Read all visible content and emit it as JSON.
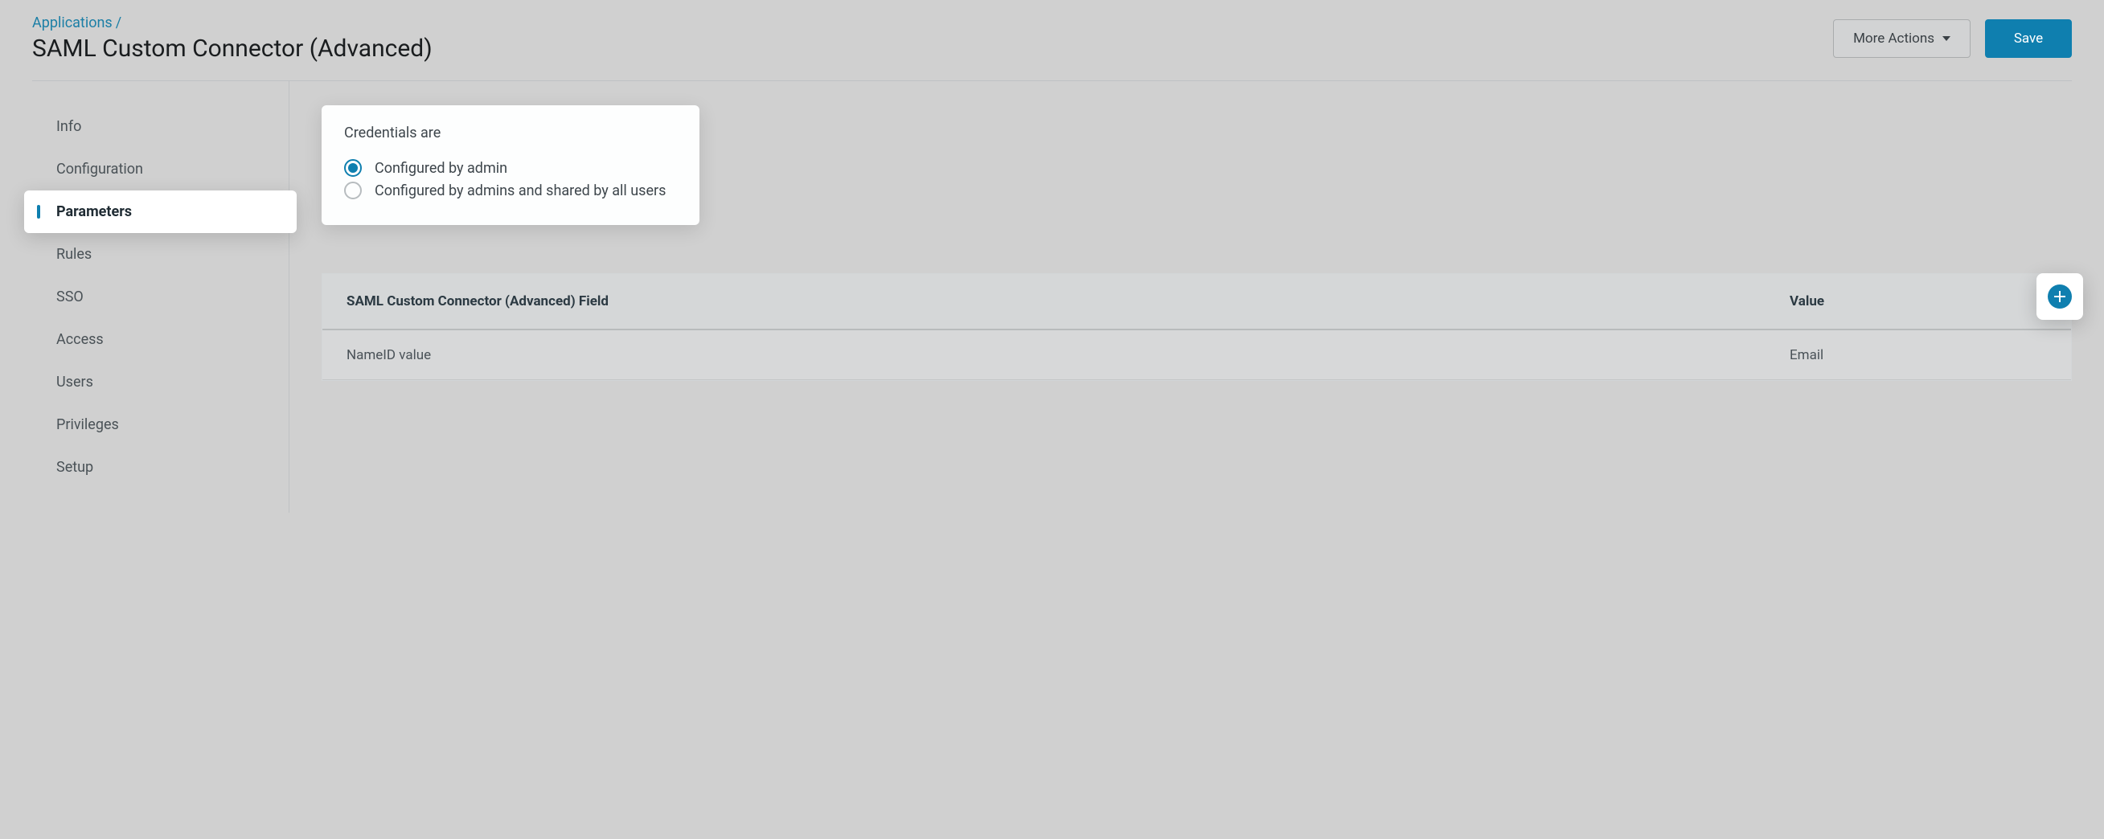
{
  "breadcrumb": {
    "parent": "Applications",
    "separator": "/"
  },
  "page_title": "SAML Custom Connector (Advanced)",
  "header": {
    "more_actions_label": "More Actions",
    "save_label": "Save"
  },
  "sidebar": {
    "items": [
      {
        "label": "Info"
      },
      {
        "label": "Configuration"
      },
      {
        "label": "Parameters"
      },
      {
        "label": "Rules"
      },
      {
        "label": "SSO"
      },
      {
        "label": "Access"
      },
      {
        "label": "Users"
      },
      {
        "label": "Privileges"
      },
      {
        "label": "Setup"
      }
    ],
    "active_index": 2
  },
  "credentials": {
    "title": "Credentials are",
    "options": [
      {
        "label": "Configured by admin",
        "selected": true
      },
      {
        "label": "Configured by admins and shared by all users",
        "selected": false
      }
    ]
  },
  "param_table": {
    "header_field": "SAML Custom Connector (Advanced) Field",
    "header_value": "Value",
    "rows": [
      {
        "field": "NameID value",
        "value": "Email"
      }
    ]
  },
  "icons": {
    "add": "plus-icon",
    "caret": "chevron-down-icon"
  }
}
